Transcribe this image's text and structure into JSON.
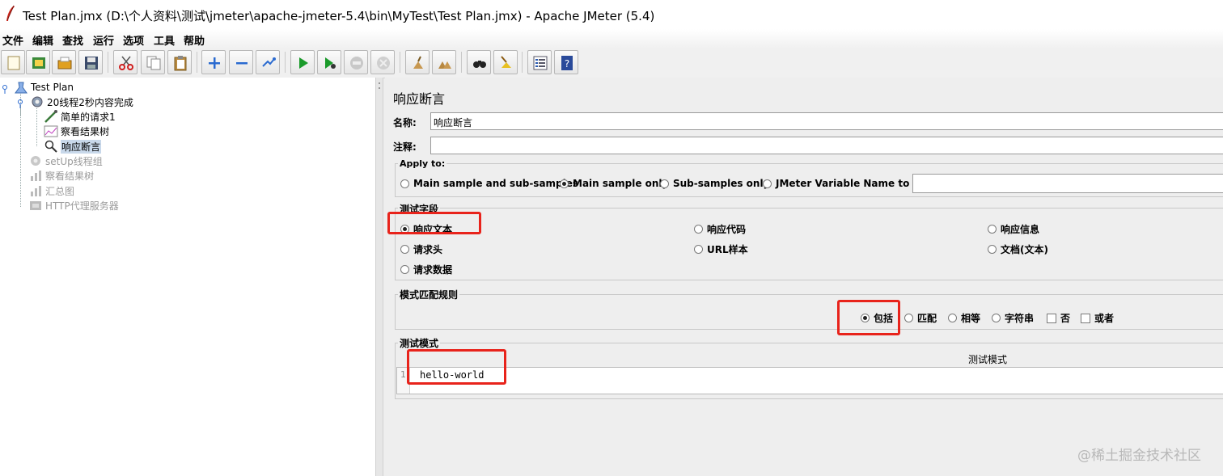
{
  "window": {
    "title": "Test Plan.jmx (D:\\个人资料\\测试\\jmeter\\apache-jmeter-5.4\\bin\\MyTest\\Test Plan.jmx) - Apache JMeter (5.4)"
  },
  "menu": [
    "文件",
    "编辑",
    "查找",
    "运行",
    "选项",
    "工具",
    "帮助"
  ],
  "toolbar": {
    "buttons": [
      "new-icon",
      "templates-icon",
      "open-icon",
      "save-icon",
      "cut-icon",
      "copy-icon",
      "paste-icon",
      "expand-icon",
      "collapse-icon",
      "toggle-icon",
      "start-icon",
      "start-no-pause-icon",
      "stop-icon",
      "shutdown-icon",
      "clear-icon",
      "clear-all-icon",
      "search-icon",
      "reset-search-icon",
      "function-helper-icon",
      "help-icon"
    ]
  },
  "tree": {
    "root": "Test Plan",
    "thread_group": "20线程2秒内容完成",
    "children": [
      "简单的请求1",
      "察看结果树",
      "响应断言"
    ],
    "disabled": [
      "setUp线程组",
      "察看结果树",
      "汇总图",
      "HTTP代理服务器"
    ],
    "selected": "响应断言"
  },
  "panel": {
    "title": "响应断言",
    "name_label": "名称:",
    "name_value": "响应断言",
    "comment_label": "注释:",
    "comment_value": "",
    "apply_to": {
      "legend": "Apply to:",
      "options": [
        "Main sample and sub-samples",
        "Main sample only",
        "Sub-samples only",
        "JMeter Variable Name to use"
      ],
      "selected_index": 1,
      "variable_value": ""
    },
    "test_field": {
      "legend": "测试字段",
      "options": [
        "响应文本",
        "响应代码",
        "响应信息",
        "请求头",
        "URL样本",
        "文档(文本)",
        "请求数据"
      ],
      "selected": "响应文本"
    },
    "pattern_rule": {
      "legend": "模式匹配规则",
      "radios": [
        "包括",
        "匹配",
        "相等",
        "字符串"
      ],
      "selected": "包括",
      "checkboxes": [
        "否",
        "或者"
      ]
    },
    "patterns": {
      "legend": "测试模式",
      "column_header": "测试模式",
      "rows": [
        {
          "num": "1",
          "value": "hello-world"
        }
      ]
    }
  },
  "watermark": "@稀土掘金技术社区",
  "colors": {
    "highlight": "#e8231b",
    "selection": "#c8d8ea"
  }
}
